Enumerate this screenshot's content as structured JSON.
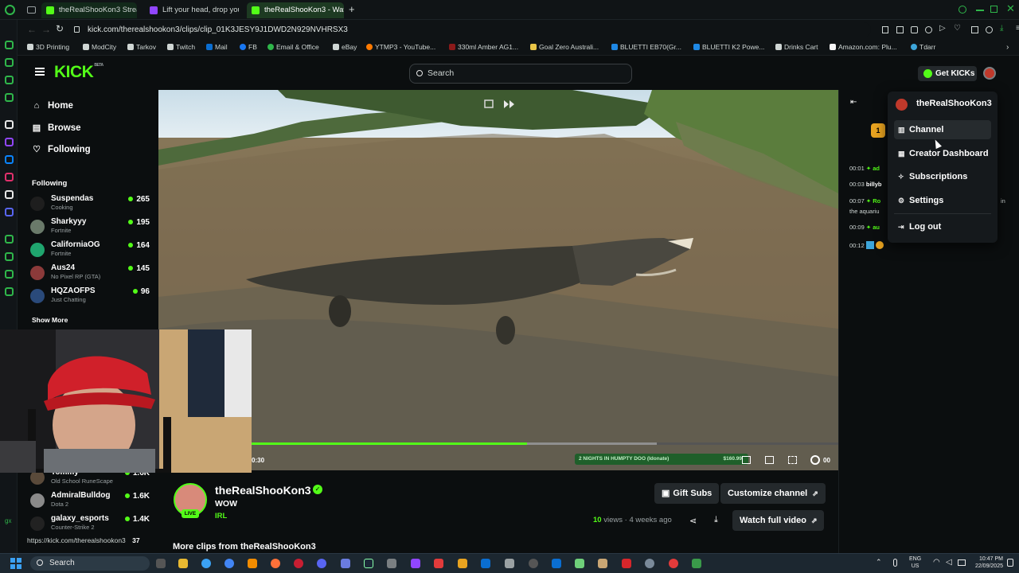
{
  "browser": {
    "tabs": [
      {
        "title": "theRealShooKon3 Stream"
      },
      {
        "title": "Lift your head, drop your"
      },
      {
        "title": "theRealShooKon3 - Watc"
      }
    ],
    "url": "kick.com/therealshookon3/clips/clip_01K3JESY9J1DWD2N929NVHRSX3",
    "bookmarks": [
      "3D Printing",
      "ModCity",
      "Tarkov",
      "Twitch",
      "Mail",
      "FB",
      "Email & Office",
      "eBay",
      "YTMP3 - YouTube...",
      "330ml Amber AG1...",
      "Goal Zero Australi...",
      "BLUETTI EB70(Gr...",
      "BLUETTI K2 Powe...",
      "Drinks Cart",
      "Amazon.com: Plu...",
      "Tdarr"
    ]
  },
  "header": {
    "logo": "KICK",
    "logo_beta": "BETA",
    "search_placeholder": "Search",
    "get_kicks": "Get KICKs"
  },
  "sidebar": {
    "nav": [
      {
        "label": "Home",
        "icon": "home-icon"
      },
      {
        "label": "Browse",
        "icon": "browse-icon"
      },
      {
        "label": "Following",
        "icon": "heart-icon"
      }
    ],
    "following_title": "Following",
    "following": [
      {
        "name": "Suspendas",
        "game": "Cooking",
        "viewers": "265"
      },
      {
        "name": "Sharkyyy",
        "game": "Fortnite",
        "viewers": "195"
      },
      {
        "name": "CaliforniaOG",
        "game": "Fortnite",
        "viewers": "164"
      },
      {
        "name": "Aus24",
        "game": "No Pixel RP (GTA)",
        "viewers": "145"
      },
      {
        "name": "HQZAOFPS",
        "game": "Just Chatting",
        "viewers": "96"
      }
    ],
    "show_more": "Show More",
    "recommended": [
      {
        "name": "Tommy",
        "game": "Old School RuneScape",
        "viewers": "1.6K"
      },
      {
        "name": "AdmiralBulldog",
        "game": "Dota 2",
        "viewers": "1.6K"
      },
      {
        "name": "galaxy_esports",
        "game": "Counter-Strike 2",
        "viewers": "1.4K"
      }
    ],
    "status_url": "https://kick.com/therealshookon3",
    "status_extra": "37"
  },
  "player": {
    "time": "0:30",
    "end_time": "00",
    "progress_fraction": 0.47,
    "buffer_fraction": 0.69,
    "overlay_text": "2 NIGHTS IN HUMPTY DOO (Idonate)",
    "overlay_amount": "$160.99"
  },
  "channel": {
    "name": "theRealShooKon3",
    "clip_title": "WOW",
    "category": "IRL",
    "live_badge": "LIVE",
    "views_count": "10",
    "views_label": "views",
    "time_ago": "4 weeks ago",
    "gift_subs": "Gift Subs",
    "customize": "Customize channel",
    "watch_full": "Watch full video",
    "more_clips": "More clips from theRealShooKon3"
  },
  "chat": {
    "badge_count": "1",
    "lines": [
      {
        "time": "00:01",
        "text": "ad"
      },
      {
        "time": "00:03",
        "text": "billyb"
      },
      {
        "time": "00:07",
        "text": "Ro"
      },
      {
        "time": "",
        "text": "the aquariu"
      },
      {
        "time": "00:09",
        "text": "au"
      },
      {
        "time": "00:12",
        "text": ""
      }
    ],
    "right_fragment": "in"
  },
  "dropdown": {
    "username": "theRealShooKon3",
    "items": [
      {
        "label": "Channel",
        "icon": "channel-icon"
      },
      {
        "label": "Creator Dashboard",
        "icon": "dashboard-icon"
      },
      {
        "label": "Subscriptions",
        "icon": "subscriptions-icon"
      },
      {
        "label": "Settings",
        "icon": "settings-icon"
      },
      {
        "label": "Log out",
        "icon": "logout-icon"
      }
    ]
  },
  "taskbar": {
    "search": "Search",
    "lang": "ENG",
    "region": "US",
    "time": "10:47 PM",
    "date": "22/09/2025"
  },
  "colors": {
    "accent": "#53fc18",
    "background": "#0b0e0f",
    "verified": "#53fc18"
  }
}
